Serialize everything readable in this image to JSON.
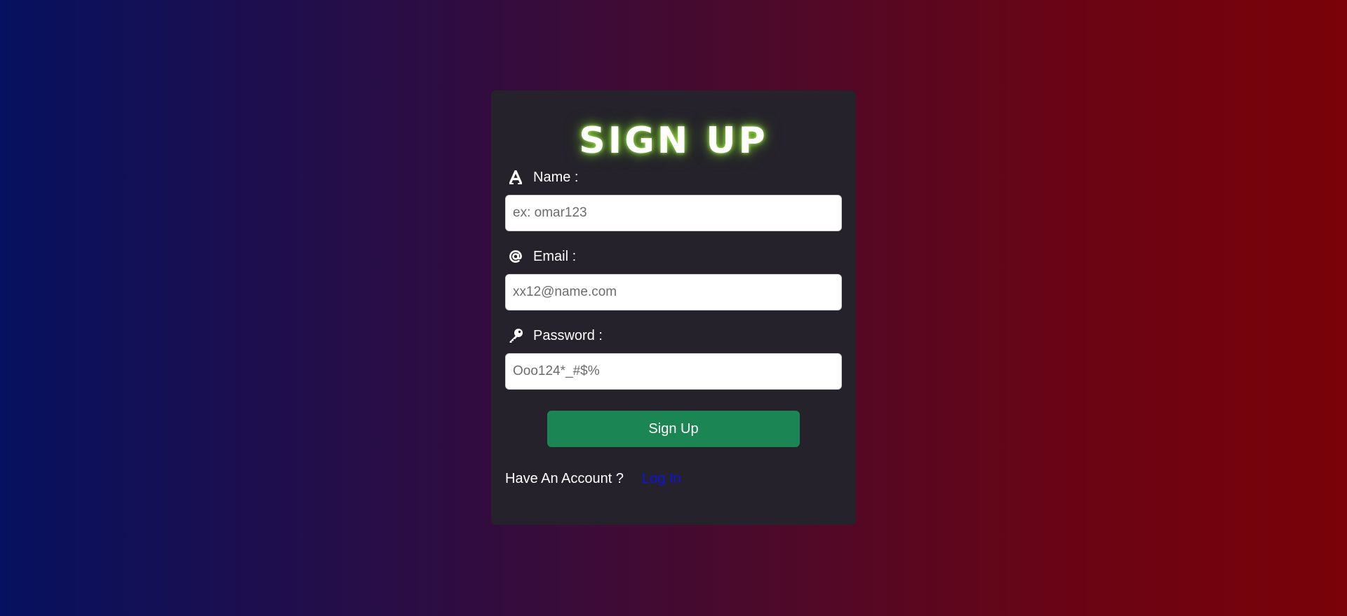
{
  "form": {
    "title": "SIGN UP",
    "fields": [
      {
        "label": "Name :",
        "icon": "letter-a-icon",
        "placeholder": "ex: omar123"
      },
      {
        "label": "Email :",
        "icon": "at-sign-icon",
        "placeholder": "xx12@name.com"
      },
      {
        "label": "Password :",
        "icon": "key-icon",
        "placeholder": "Ooo124*_#$%"
      }
    ],
    "submit_label": "Sign Up",
    "footer": {
      "prompt": "Have An Account ?",
      "link_label": "Log In"
    }
  },
  "colors": {
    "card_background": "#25222b",
    "submit_button": "#1b8553",
    "title_glow": "#8ce632",
    "link": "#1010e8"
  }
}
